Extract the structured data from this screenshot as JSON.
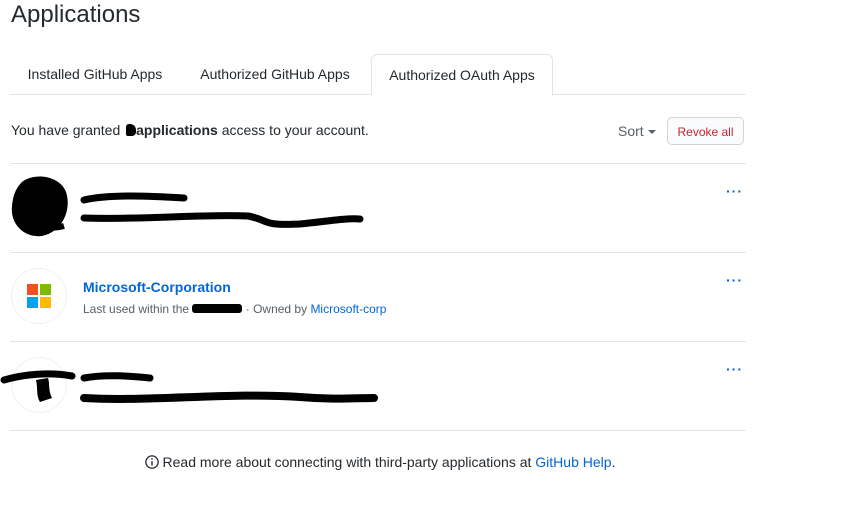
{
  "page": {
    "title": "Applications"
  },
  "tabs": [
    {
      "label": "Installed GitHub Apps",
      "active": false
    },
    {
      "label": "Authorized GitHub Apps",
      "active": false
    },
    {
      "label": "Authorized OAuth Apps",
      "active": true
    }
  ],
  "summary": {
    "prefix": "You have granted ",
    "bold": "applications",
    "suffix": " access to your account."
  },
  "controls": {
    "sort_label": "Sort",
    "revoke_all_label": "Revoke all"
  },
  "apps": [
    {
      "name": "",
      "meta_prefix": "",
      "meta_owner": "",
      "redacted": true
    },
    {
      "name": "Microsoft-Corporation",
      "meta_prefix": "Last used within the ",
      "meta_middle": " · Owned by ",
      "meta_owner": "Microsoft-corp",
      "redacted": false
    },
    {
      "name": "",
      "meta_prefix": "",
      "meta_owner": "",
      "redacted": true
    }
  ],
  "more_label": "···",
  "footer": {
    "text": "Read more about connecting with third-party applications at ",
    "link": "GitHub Help",
    "end": "."
  },
  "colors": {
    "link": "#0366d6",
    "danger": "#cb2431",
    "border": "#e1e4e8",
    "ms_red": "#f25022",
    "ms_green": "#7fba00",
    "ms_blue": "#00a4ef",
    "ms_yellow": "#ffb900"
  },
  "icons": [
    "info-icon",
    "caret-down-icon",
    "microsoft-logo",
    "kebab-icon"
  ]
}
